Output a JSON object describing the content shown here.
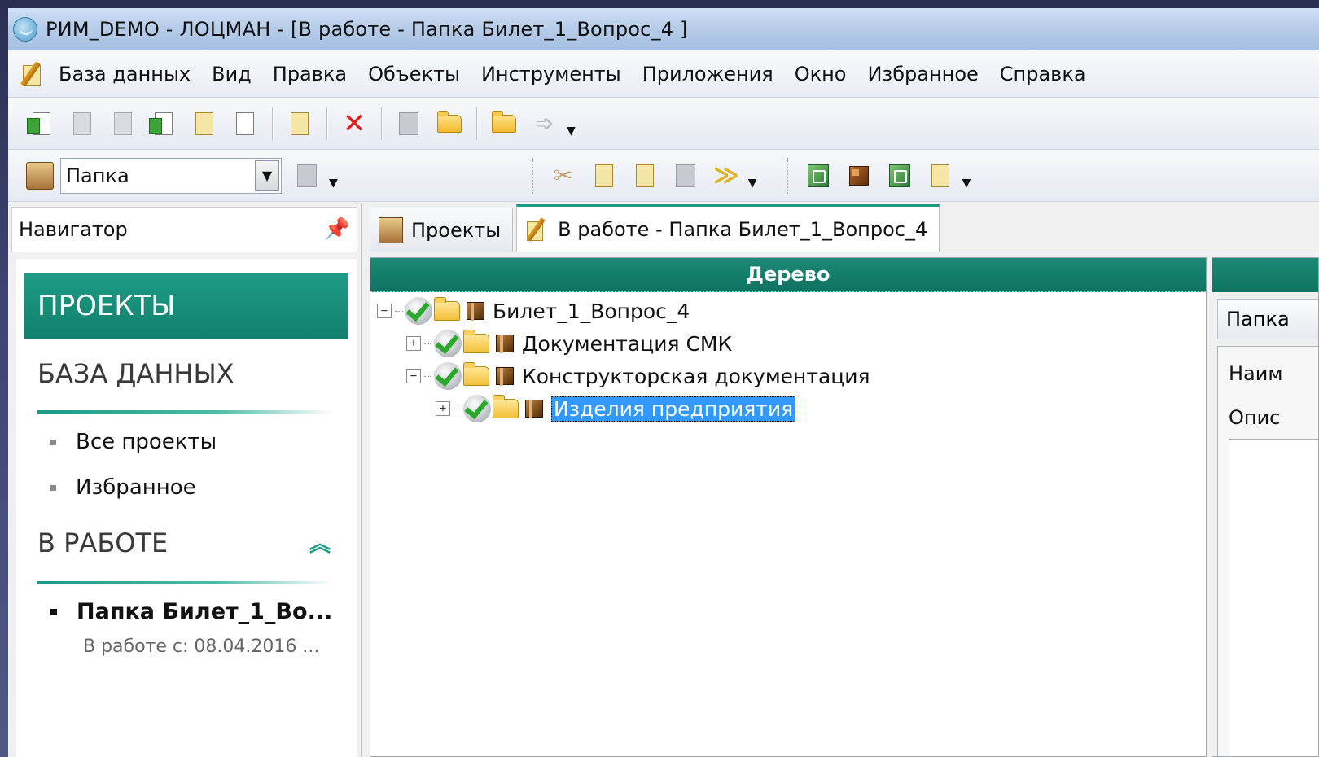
{
  "window": {
    "title": "РИМ_DEMO - ЛОЦМАН - [В работе - Папка Билет_1_Вопрос_4 ]"
  },
  "menu": [
    "База данных",
    "Вид",
    "Правка",
    "Объекты",
    "Инструменты",
    "Приложения",
    "Окно",
    "Избранное",
    "Справка"
  ],
  "toolbar": {
    "object_type": "Папка"
  },
  "navigator": {
    "title": "Навигатор",
    "projects_banner": "ПРОЕКТЫ",
    "database_title": "БАЗА ДАННЫХ",
    "database_items": [
      "Все проекты",
      "Избранное"
    ],
    "in_work_title": "В РАБОТЕ",
    "in_work_item": "Папка Билет_1_Во...",
    "in_work_sub": "В работе с: 08.04.2016 ..."
  },
  "tabs": [
    "Проекты",
    "В работе - Папка Билет_1_Вопрос_4"
  ],
  "tree": {
    "header": "Дерево",
    "nodes": [
      {
        "label": "Билет_1_Вопрос_4",
        "expander": "−"
      },
      {
        "label": "Документация СМК",
        "expander": "+"
      },
      {
        "label": "Конструкторская документация",
        "expander": "−"
      },
      {
        "label": "Изделия предприятия",
        "expander": "+"
      }
    ]
  },
  "props": {
    "tab": "Папка",
    "name_label": "Наим",
    "desc_label": "Опис"
  },
  "colors": {
    "accent": "#1b9a84",
    "selection": "#3399ff"
  }
}
